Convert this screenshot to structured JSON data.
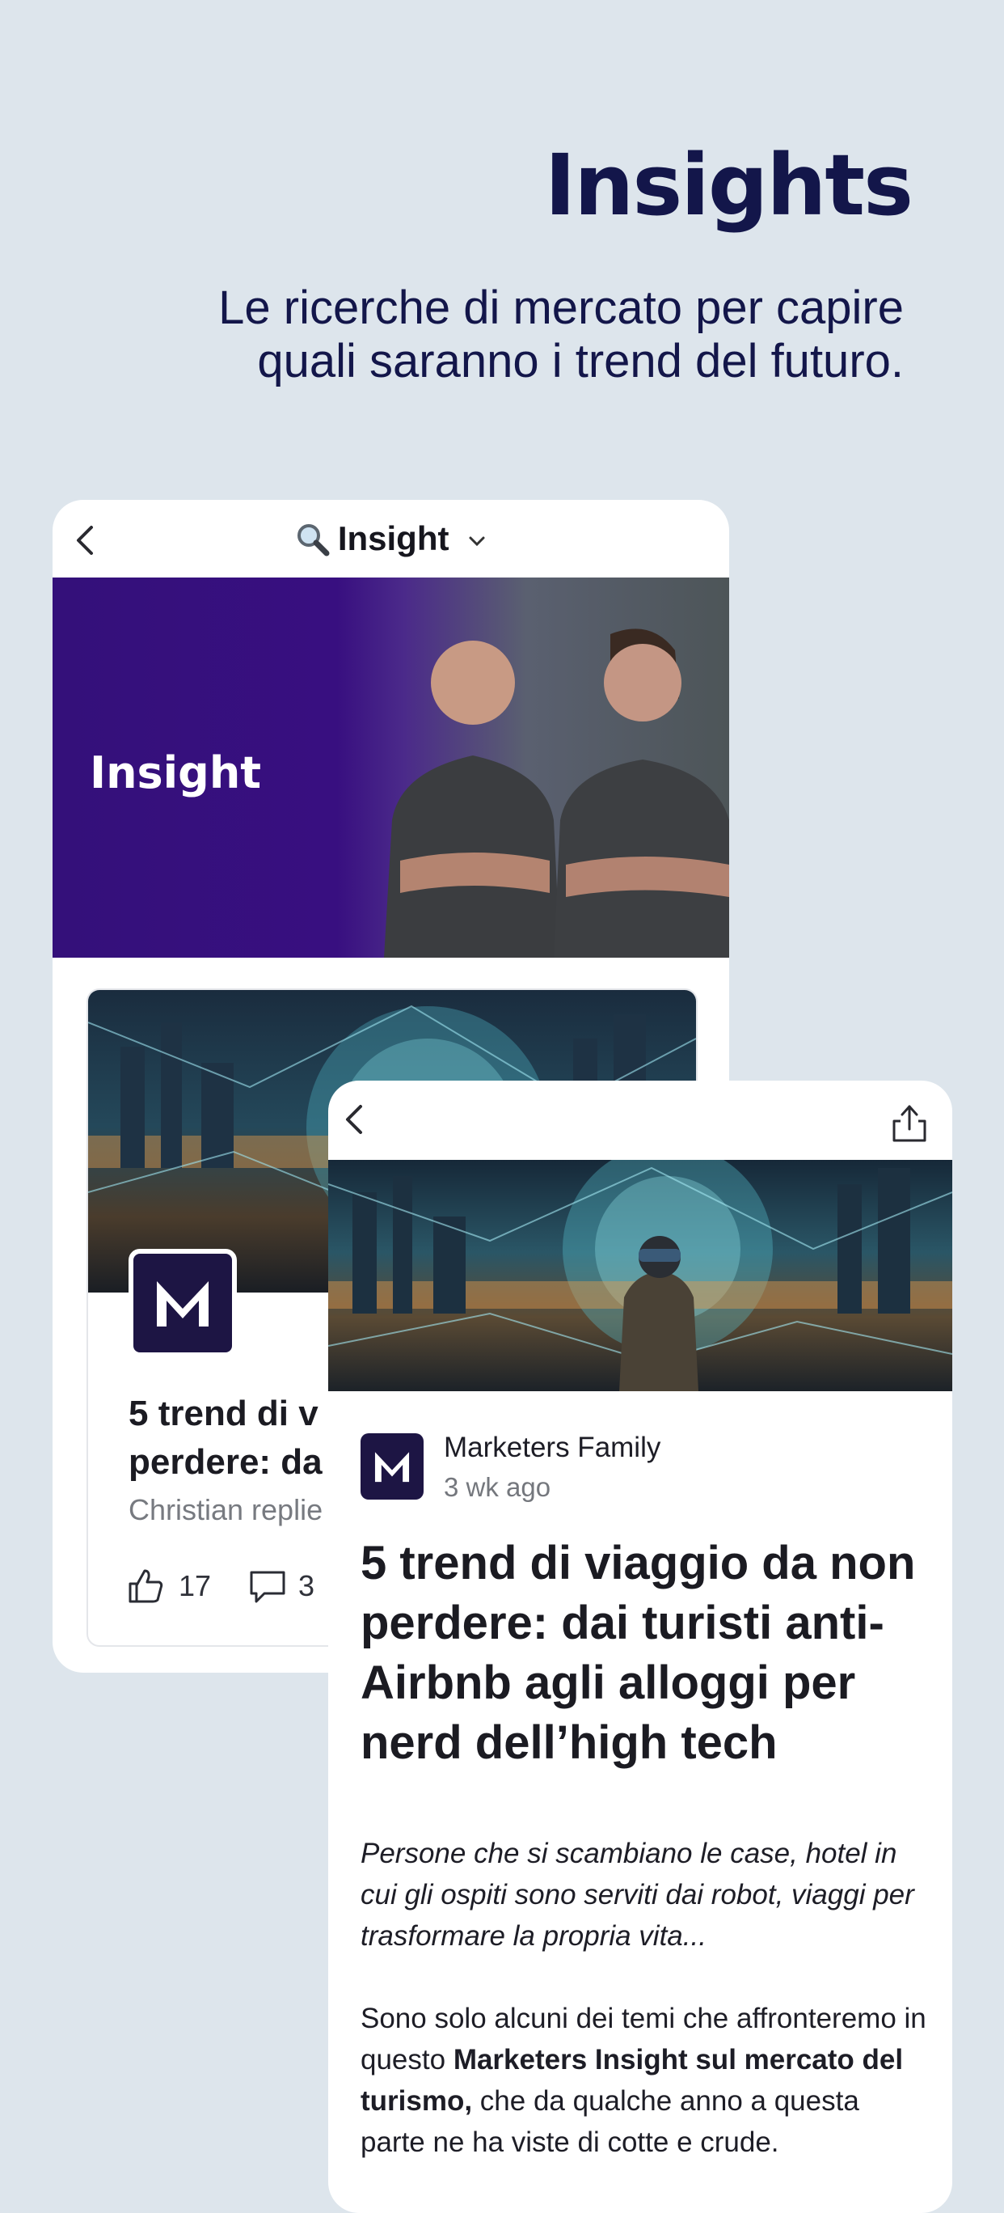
{
  "hero": {
    "title": "Insights",
    "subtitle": "Le ricerche di mercato per capire\nquali saranno i trend del futuro."
  },
  "back_card": {
    "nav_title": "Insight",
    "icons": {
      "back": "chevron-left-icon",
      "search": "magnifier-icon",
      "dropdown": "chevron-down-icon"
    },
    "banner_label": "Insight",
    "post": {
      "headline": "5 trend di v\nperdere: da",
      "meta": "Christian replie",
      "likes": "17",
      "comments": "3"
    }
  },
  "front_card": {
    "icons": {
      "back": "chevron-left-icon",
      "share": "share-icon"
    },
    "author": "Marketers Family",
    "time": "3 wk ago",
    "title": "5 trend di viaggio da non\nperdere: dai turisti anti-\nAirbnb agli alloggi per\nnerd dell’high tech",
    "lede": "Persone che si scambiano le case, hotel in\ncui gli ospiti sono serviti dai robot, viaggi per\ntrasformare la propria vita...",
    "body": {
      "part1": "Sono solo alcuni dei temi che affronteremo in\nquesto ",
      "bold": "Marketers Insight sul mercato del\nturismo,",
      "part2": " che da qualche anno a questa\nparte ne ha viste di cotte e crude."
    }
  },
  "colors": {
    "background": "#dde5ec",
    "heading": "#13164a",
    "brand_purple": "#380f80",
    "logo_bg": "#1d1544"
  }
}
